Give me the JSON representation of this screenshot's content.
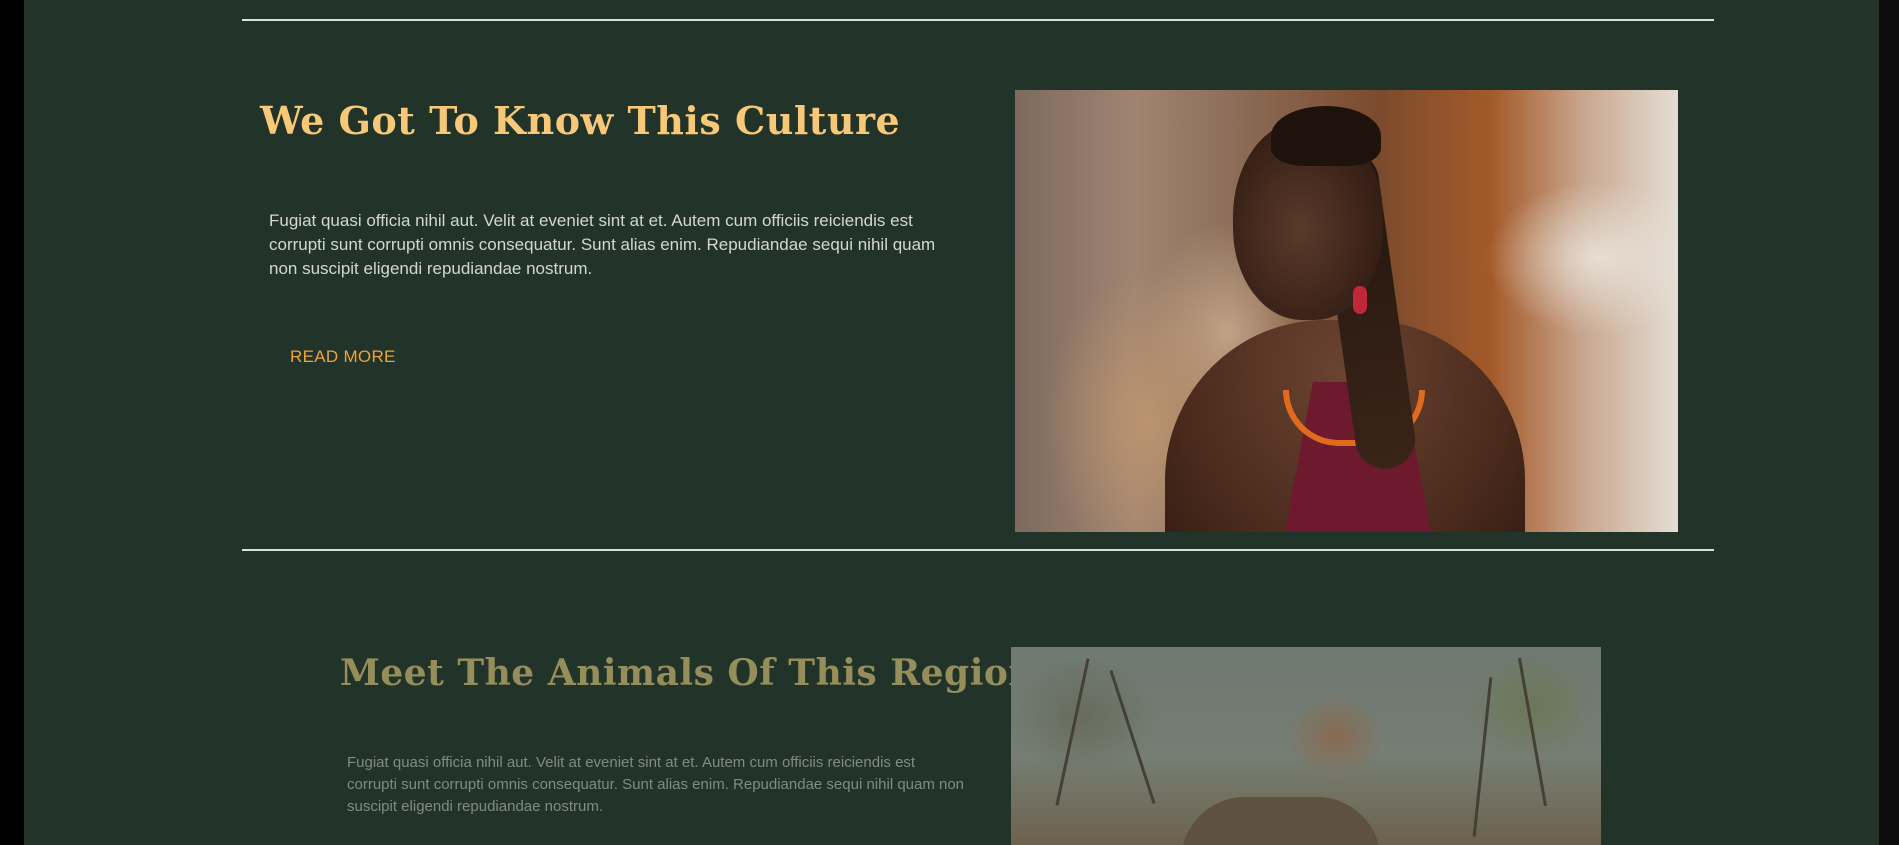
{
  "sections": [
    {
      "heading": "We Got To Know This Culture",
      "paragraph": "Fugiat quasi officia nihil aut. Velit at eveniet sint at et. Autem cum officiis reiciendis est corrupti sunt corrupti omnis consequatur. Sunt alias enim. Repudiandae sequi nihil quam non suscipit eligendi repudiandae nostrum.",
      "button_label": "READ MORE",
      "image": "portrait-of-woman-with-braids-and-beaded-necklace"
    },
    {
      "heading": "Meet The Animals Of This Region",
      "paragraph": "Fugiat quasi officia nihil aut. Velit at eveniet sint at et. Autem cum officiis reiciendis est corrupti sunt corrupti omnis consequatur. Sunt alias enim. Repudiandae sequi nihil quam non suscipit eligendi repudiandae nostrum.",
      "image": "elephants-in-savanna-with-trees"
    }
  ],
  "colors": {
    "background": "#223429",
    "heading_active": "#f6c878",
    "heading_faded": "#958e5b",
    "body_text": "#d3d7d0",
    "body_text_faded": "#808b82",
    "accent": "#f0a23b",
    "divider": "#d9e3d6"
  }
}
